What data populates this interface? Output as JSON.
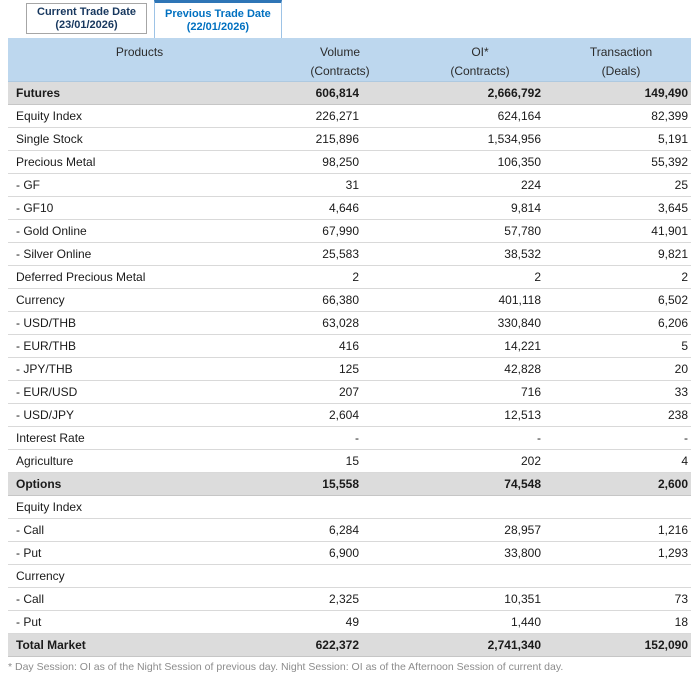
{
  "tabs": [
    {
      "line1": "Current Trade Date",
      "line2": "(23/01/2026)",
      "active": false
    },
    {
      "line1": "Previous Trade Date",
      "line2": "(22/01/2026)",
      "active": true
    }
  ],
  "table": {
    "columns": [
      {
        "line1": "Products",
        "line2": ""
      },
      {
        "line1": "Volume",
        "line2": "(Contracts)"
      },
      {
        "line1": "OI*",
        "line2": "(Contracts)"
      },
      {
        "line1": "Transaction",
        "line2": "(Deals)"
      }
    ],
    "rows": [
      {
        "product": "Futures",
        "volume": "606,814",
        "oi": "2,666,792",
        "transaction": "149,490",
        "style": "section"
      },
      {
        "product": "Equity Index",
        "volume": "226,271",
        "oi": "624,164",
        "transaction": "82,399"
      },
      {
        "product": "Single Stock",
        "volume": "215,896",
        "oi": "1,534,956",
        "transaction": "5,191"
      },
      {
        "product": "Precious Metal",
        "volume": "98,250",
        "oi": "106,350",
        "transaction": "55,392"
      },
      {
        "product": "- GF",
        "volume": "31",
        "oi": "224",
        "transaction": "25"
      },
      {
        "product": "- GF10",
        "volume": "4,646",
        "oi": "9,814",
        "transaction": "3,645"
      },
      {
        "product": "- Gold Online",
        "volume": "67,990",
        "oi": "57,780",
        "transaction": "41,901"
      },
      {
        "product": "- Silver Online",
        "volume": "25,583",
        "oi": "38,532",
        "transaction": "9,821"
      },
      {
        "product": "Deferred Precious Metal",
        "volume": "2",
        "oi": "2",
        "transaction": "2"
      },
      {
        "product": "Currency",
        "volume": "66,380",
        "oi": "401,118",
        "transaction": "6,502"
      },
      {
        "product": "- USD/THB",
        "volume": "63,028",
        "oi": "330,840",
        "transaction": "6,206"
      },
      {
        "product": "- EUR/THB",
        "volume": "416",
        "oi": "14,221",
        "transaction": "5"
      },
      {
        "product": "- JPY/THB",
        "volume": "125",
        "oi": "42,828",
        "transaction": "20"
      },
      {
        "product": "- EUR/USD",
        "volume": "207",
        "oi": "716",
        "transaction": "33"
      },
      {
        "product": "- USD/JPY",
        "volume": "2,604",
        "oi": "12,513",
        "transaction": "238"
      },
      {
        "product": "Interest Rate",
        "volume": "-",
        "oi": "-",
        "transaction": "-"
      },
      {
        "product": "Agriculture",
        "volume": "15",
        "oi": "202",
        "transaction": "4"
      },
      {
        "product": "Options",
        "volume": "15,558",
        "oi": "74,548",
        "transaction": "2,600",
        "style": "section"
      },
      {
        "product": "Equity Index",
        "volume": "",
        "oi": "",
        "transaction": ""
      },
      {
        "product": "- Call",
        "volume": "6,284",
        "oi": "28,957",
        "transaction": "1,216"
      },
      {
        "product": "- Put",
        "volume": "6,900",
        "oi": "33,800",
        "transaction": "1,293"
      },
      {
        "product": "Currency",
        "volume": "",
        "oi": "",
        "transaction": ""
      },
      {
        "product": "- Call",
        "volume": "2,325",
        "oi": "10,351",
        "transaction": "73"
      },
      {
        "product": "- Put",
        "volume": "49",
        "oi": "1,440",
        "transaction": "18"
      },
      {
        "product": "Total Market",
        "volume": "622,372",
        "oi": "2,741,340",
        "transaction": "152,090",
        "style": "section"
      }
    ]
  },
  "footnote": "* Day Session: OI as of the Night Session of previous day. Night Session: OI as of the Afternoon Session of current day."
}
